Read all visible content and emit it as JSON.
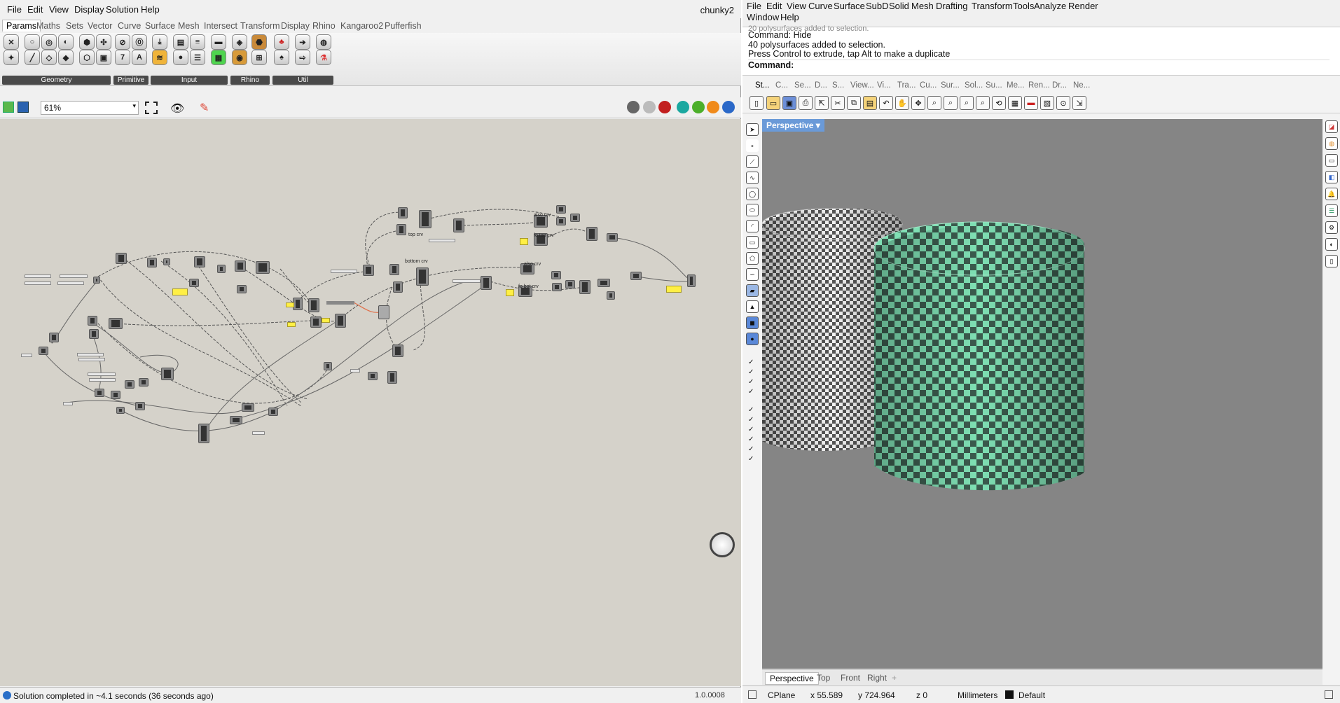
{
  "grasshopper": {
    "menu": [
      "File",
      "Edit",
      "View",
      "Display",
      "Solution",
      "Help"
    ],
    "title": "chunky2",
    "tabs": [
      "Params",
      "Maths",
      "Sets",
      "Vector",
      "Curve",
      "Surface",
      "Mesh",
      "Intersect",
      "Transform",
      "Display",
      "Rhino",
      "Kangaroo2",
      "Pufferfish"
    ],
    "ribbon_groups": [
      "Geometry",
      "Primitive",
      "Input",
      "Rhino",
      "Util"
    ],
    "zoom": "61%",
    "canvas_labels": [
      "top crv",
      "bottom crv",
      "also crv",
      "fo top crv",
      "also crv",
      "fo bot crv"
    ],
    "status": "Solution completed in ~4.1 seconds (36 seconds ago)",
    "version": "1.0.0008"
  },
  "rhino": {
    "menu_row1": [
      "File",
      "Edit",
      "View",
      "Curve",
      "Surface",
      "SubD",
      "Solid",
      "Mesh",
      "Drafting",
      "Transform",
      "Tools",
      "Analyze",
      "Render"
    ],
    "menu_row2": [
      "Window",
      "Help"
    ],
    "command_history": [
      "Command: Hide",
      "40 polysurfaces added to selection.",
      "Press Control to extrude, tap Alt to make a duplicate"
    ],
    "command_prompt": "Command:",
    "toolbar_tabs": [
      "St...",
      "C...",
      "Se...",
      "D...",
      "S...",
      "View...",
      "Vi...",
      "Tra...",
      "Cu...",
      "Sur...",
      "Sol...",
      "Su...",
      "Me...",
      "Ren...",
      "Dr...",
      "Ne..."
    ],
    "viewport_name": "Perspective",
    "viewport_tabs": [
      "Perspective",
      "Top",
      "Front",
      "Right"
    ],
    "status": {
      "cplane": "CPlane",
      "x": "x 55.589",
      "y": "y 724.964",
      "z": "z 0",
      "units": "Millimeters",
      "layer": "Default"
    }
  },
  "colors": {
    "accent_green": "#7fe0b4",
    "viewport_bg": "#858585",
    "panel_yellow": "#ffef45"
  }
}
